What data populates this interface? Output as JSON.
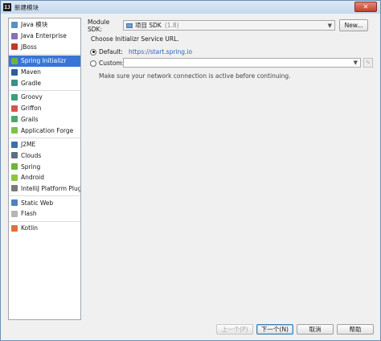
{
  "window": {
    "title": "新建模块",
    "app_icon": "IJ"
  },
  "sidebar": {
    "groups": [
      {
        "items": [
          {
            "label": "Java 模块",
            "icon": "folder-icon",
            "color": "#5b8fc7"
          },
          {
            "label": "Java Enterprise",
            "icon": "enterprise-icon",
            "color": "#8a6fb5"
          },
          {
            "label": "JBoss",
            "icon": "jboss-icon",
            "color": "#c0392b"
          }
        ]
      },
      {
        "items": [
          {
            "label": "Spring Initializr",
            "icon": "spring-initializr-icon",
            "color": "#6db33f",
            "selected": true
          },
          {
            "label": "Maven",
            "icon": "maven-icon",
            "color": "#2f5c9c"
          },
          {
            "label": "Gradle",
            "icon": "gradle-icon",
            "color": "#3a8f86"
          }
        ]
      },
      {
        "items": [
          {
            "label": "Groovy",
            "icon": "groovy-icon",
            "color": "#3e9d7c"
          },
          {
            "label": "Griffon",
            "icon": "griffon-icon",
            "color": "#d9534f"
          },
          {
            "label": "Grails",
            "icon": "grails-icon",
            "color": "#4aa86a"
          },
          {
            "label": "Application Forge",
            "icon": "application-forge-icon",
            "color": "#7cc04b"
          }
        ]
      },
      {
        "items": [
          {
            "label": "J2ME",
            "icon": "j2me-icon",
            "color": "#3d6fb0"
          },
          {
            "label": "Clouds",
            "icon": "clouds-icon",
            "color": "#5e6f80"
          },
          {
            "label": "Spring",
            "icon": "spring-icon",
            "color": "#6db33f"
          },
          {
            "label": "Android",
            "icon": "android-icon",
            "color": "#8cc63f"
          },
          {
            "label": "IntelliJ Platform Plugin",
            "icon": "plugin-icon",
            "color": "#7a7a7a"
          }
        ]
      },
      {
        "items": [
          {
            "label": "Static Web",
            "icon": "static-web-icon",
            "color": "#4f80c0"
          },
          {
            "label": "Flash",
            "icon": "flash-icon",
            "color": "#b5b5b5"
          }
        ]
      },
      {
        "items": [
          {
            "label": "Kotlin",
            "icon": "kotlin-icon",
            "color": "#e0703a"
          }
        ]
      }
    ]
  },
  "main": {
    "sdk_label": "Module SDK:",
    "sdk_value": "项目 SDK",
    "sdk_version": "(1.8)",
    "new_button": "New...",
    "choose_text": "Choose Initializr Service URL.",
    "default_label": "Default:",
    "default_url": "https://start.spring.io",
    "custom_label": "Custom:",
    "custom_value": "",
    "note": "Make sure your network connection is active before continuing."
  },
  "footer": {
    "prev": "上一个(P)",
    "next": "下一个(N)",
    "cancel": "取消",
    "help": "帮助"
  },
  "colors": {
    "selection": "#3875d7",
    "link": "#2b61b8"
  }
}
